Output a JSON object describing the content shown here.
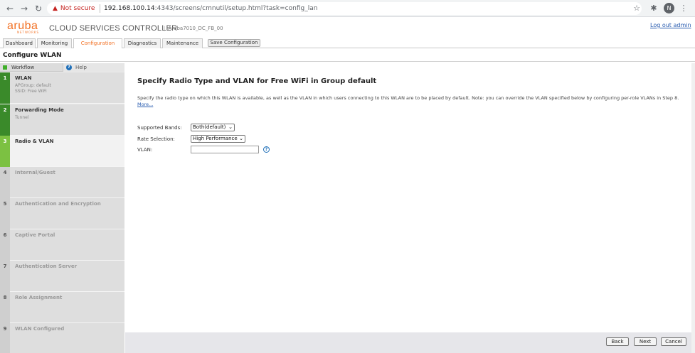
{
  "browser": {
    "security_label": "Not secure",
    "url_host": "192.168.100.14",
    "url_rest": ":4343/screens/cmnutil/setup.html?task=config_lan",
    "avatar_initial": "N",
    "icons": [
      "back-icon",
      "forward-icon",
      "reload-icon",
      "warning-icon",
      "star-icon",
      "extensions-icon",
      "menu-icon"
    ]
  },
  "header": {
    "logo_text": "aruba",
    "logo_sub": "NETWORKS",
    "product": "CLOUD SERVICES CONTROLLER",
    "device": "Aruba7010_DC_FB_00",
    "logout": "Log out admin"
  },
  "tabs": [
    {
      "label": "Dashboard"
    },
    {
      "label": "Monitoring"
    },
    {
      "label": "Configuration",
      "active": true
    },
    {
      "label": "Diagnostics"
    },
    {
      "label": "Maintenance"
    }
  ],
  "save_config": "Save Configuration",
  "page_title": "Configure WLAN",
  "sidebar": {
    "workflow_label": "Workflow",
    "help_label": "Help",
    "steps": [
      {
        "num": "1",
        "name": "WLAN",
        "sub1": "APGroup: default",
        "sub2": "SSID: Free WiFi",
        "state": "done"
      },
      {
        "num": "2",
        "name": "Forwarding Mode",
        "sub1": "Tunnel",
        "state": "done"
      },
      {
        "num": "3",
        "name": "Radio & VLAN",
        "state": "current"
      },
      {
        "num": "4",
        "name": "Internal/Guest",
        "state": "pending"
      },
      {
        "num": "5",
        "name": "Authentication and Encryption",
        "state": "pending"
      },
      {
        "num": "6",
        "name": "Captive Portal",
        "state": "pending"
      },
      {
        "num": "7",
        "name": "Authentication Server",
        "state": "pending"
      },
      {
        "num": "8",
        "name": "Role Assignment",
        "state": "pending"
      },
      {
        "num": "9",
        "name": "WLAN Configured",
        "state": "pending"
      }
    ]
  },
  "content": {
    "title": "Specify Radio Type and VLAN for Free WiFi in Group default",
    "description": "Specify the radio type on which this WLAN is available, as well as the VLAN in which users connecting to this WLAN are to be placed by default. Note: you can override the VLAN specified below by configuring per-role VLANs in Step 8.",
    "more_link": "More...",
    "fields": {
      "bands_label": "Supported Bands:",
      "bands_value": "Both(default)",
      "rate_label": "Rate Selection:",
      "rate_value": "High Performance",
      "vlan_label": "VLAN:",
      "vlan_value": ""
    }
  },
  "buttons": {
    "back": "Back",
    "next": "Next",
    "cancel": "Cancel"
  },
  "colors": {
    "brand": "#f26f21",
    "step_done": "#3a8a2a",
    "step_current": "#7cc142",
    "link": "#2a5db0"
  }
}
